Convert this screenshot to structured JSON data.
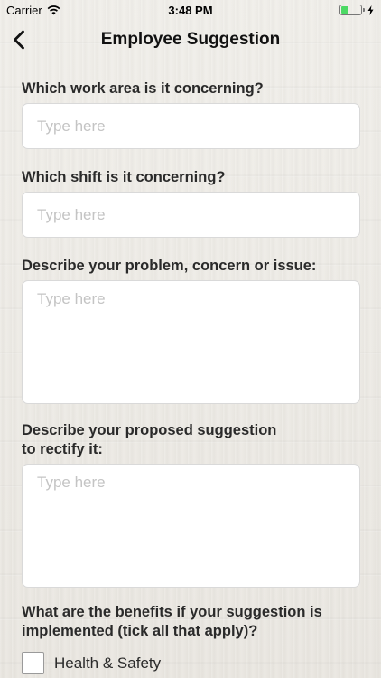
{
  "status_bar": {
    "carrier": "Carrier",
    "time": "3:48 PM"
  },
  "nav": {
    "title": "Employee Suggestion"
  },
  "form": {
    "q1": {
      "label": "Which work area is it concerning?",
      "placeholder": "Type here",
      "value": ""
    },
    "q2": {
      "label": "Which shift is it concerning?",
      "placeholder": "Type here",
      "value": ""
    },
    "q3": {
      "label": "Describe your problem, concern or issue:",
      "placeholder": "Type here",
      "value": ""
    },
    "q4": {
      "label_line1": "Describe your proposed suggestion",
      "label_line2": "to rectify it:",
      "placeholder": "Type here",
      "value": ""
    },
    "q5": {
      "label_line1": "What are the benefits if your suggestion is",
      "label_line2": "implemented (tick all that apply)?"
    },
    "options": [
      {
        "label": "Health & Safety",
        "checked": false
      }
    ]
  },
  "colors": {
    "battery": "#4cd964",
    "background": "#eeece7"
  },
  "icons": {
    "wifi": "wifi-icon",
    "back": "chevron-left-icon",
    "battery": "battery-icon",
    "charging": "bolt-icon"
  }
}
